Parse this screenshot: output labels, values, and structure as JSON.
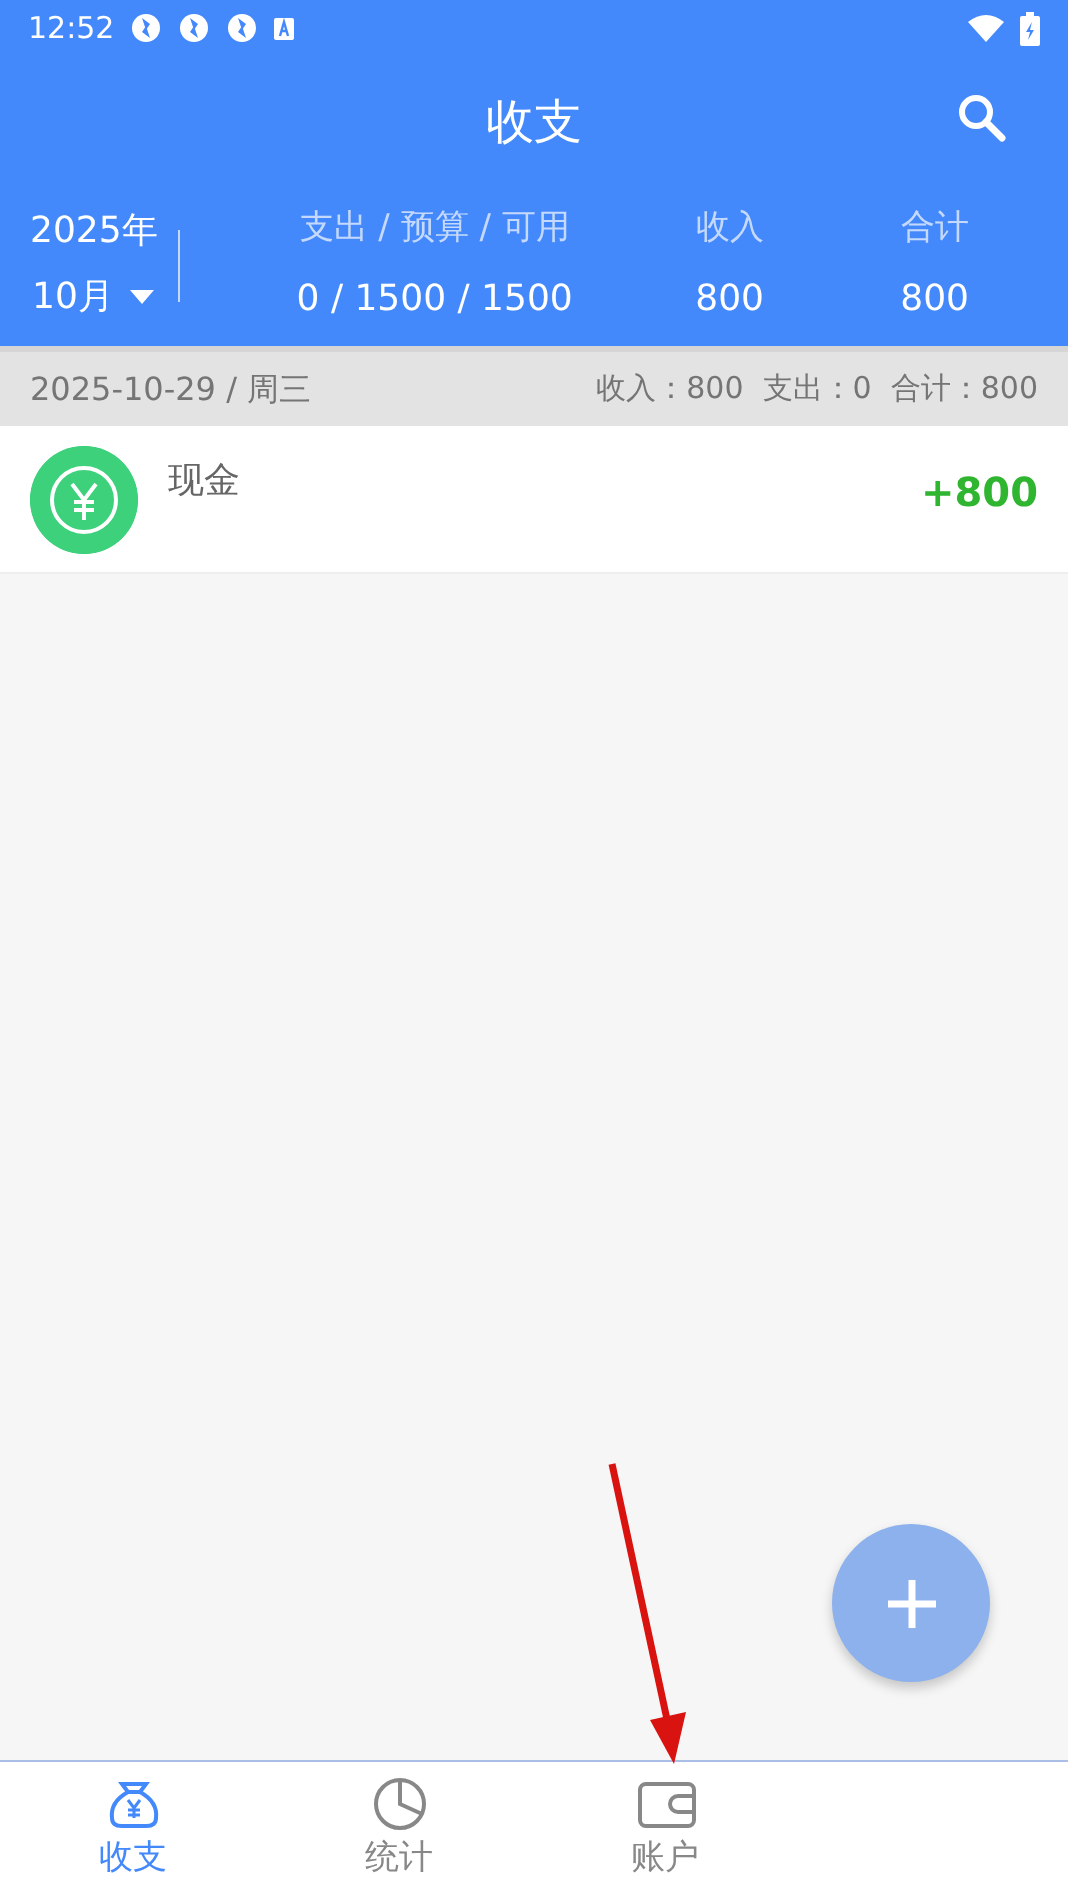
{
  "status_bar": {
    "time": "12:52"
  },
  "title": "收支",
  "summary": {
    "year": "2025年",
    "month": "10月",
    "columns": [
      {
        "label": "支出 / 预算 / 可用",
        "value": "0 / 1500 / 1500"
      },
      {
        "label": "收入",
        "value": "800"
      },
      {
        "label": "合计",
        "value": "800"
      }
    ]
  },
  "day_group": {
    "date": "2025-10-29 / 周三",
    "totals": "收入：800  支出：0  合计：800"
  },
  "records": [
    {
      "category": "现金",
      "amount": "+800",
      "kind": "income"
    }
  ],
  "tabs": [
    {
      "label": "收支",
      "selected": true,
      "kind": "bag"
    },
    {
      "label": "统计",
      "selected": false,
      "kind": "pie"
    },
    {
      "label": "账户",
      "selected": false,
      "kind": "wallet"
    }
  ]
}
